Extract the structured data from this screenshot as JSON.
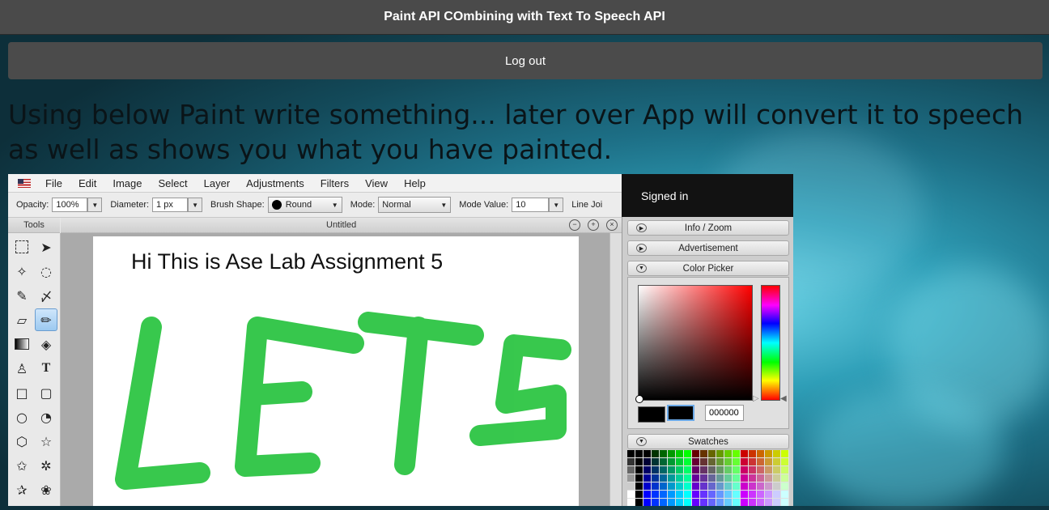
{
  "header": {
    "title": "Paint API COmbining with Text To Speech API",
    "logout_label": "Log out"
  },
  "intro_text": "Using below Paint write something... later over App will convert it to speech as well as shows you what you have painted.",
  "editor": {
    "menu": [
      "File",
      "Edit",
      "Image",
      "Select",
      "Layer",
      "Adjustments",
      "Filters",
      "View",
      "Help"
    ],
    "options": {
      "opacity_label": "Opacity:",
      "opacity_value": "100%",
      "diameter_label": "Diameter:",
      "diameter_value": "1 px",
      "brush_shape_label": "Brush Shape:",
      "brush_shape_value": "Round",
      "mode_label": "Mode:",
      "mode_value": "Normal",
      "mode_value_label": "Mode Value:",
      "mode_value_value": "10",
      "line_join_label": "Line Joi"
    },
    "tools_title": "Tools",
    "document_title": "Untitled",
    "canvas_text": "Hi This is Ase Lab Assignment 5",
    "painted_word": "LETS",
    "paint_color": "#22c23a"
  },
  "side_panel": {
    "signed_in": "Signed in",
    "sections": [
      "Info / Zoom",
      "Advertisement",
      "Color Picker",
      "Swatches"
    ],
    "hex_value": "000000"
  }
}
